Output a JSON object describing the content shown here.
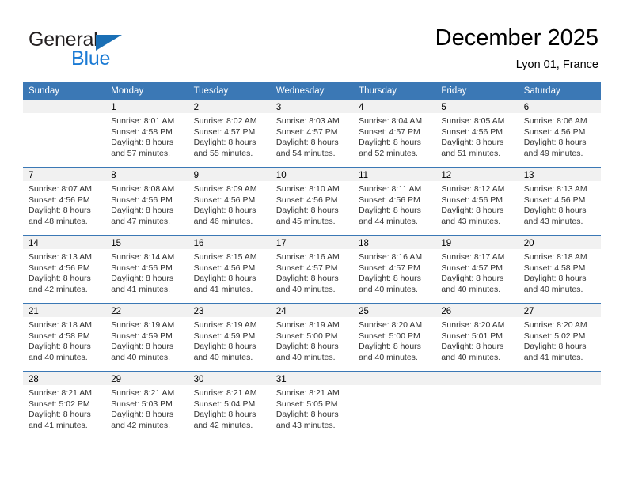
{
  "brand": {
    "logo_line1": "General",
    "logo_line2": "Blue",
    "triangle_color": "#1a6fb5",
    "blue_text_color": "#1a7ad4"
  },
  "header": {
    "title": "December 2025",
    "subtitle": "Lyon 01, France",
    "accent_color": "#3b78b5",
    "daynum_band_color": "#f1f1f1"
  },
  "calendar": {
    "weekdays": [
      "Sunday",
      "Monday",
      "Tuesday",
      "Wednesday",
      "Thursday",
      "Friday",
      "Saturday"
    ],
    "weeks": [
      [
        {
          "day": "",
          "sunrise": "",
          "sunset": "",
          "daylight1": "",
          "daylight2": ""
        },
        {
          "day": "1",
          "sunrise": "Sunrise: 8:01 AM",
          "sunset": "Sunset: 4:58 PM",
          "daylight1": "Daylight: 8 hours",
          "daylight2": "and 57 minutes."
        },
        {
          "day": "2",
          "sunrise": "Sunrise: 8:02 AM",
          "sunset": "Sunset: 4:57 PM",
          "daylight1": "Daylight: 8 hours",
          "daylight2": "and 55 minutes."
        },
        {
          "day": "3",
          "sunrise": "Sunrise: 8:03 AM",
          "sunset": "Sunset: 4:57 PM",
          "daylight1": "Daylight: 8 hours",
          "daylight2": "and 54 minutes."
        },
        {
          "day": "4",
          "sunrise": "Sunrise: 8:04 AM",
          "sunset": "Sunset: 4:57 PM",
          "daylight1": "Daylight: 8 hours",
          "daylight2": "and 52 minutes."
        },
        {
          "day": "5",
          "sunrise": "Sunrise: 8:05 AM",
          "sunset": "Sunset: 4:56 PM",
          "daylight1": "Daylight: 8 hours",
          "daylight2": "and 51 minutes."
        },
        {
          "day": "6",
          "sunrise": "Sunrise: 8:06 AM",
          "sunset": "Sunset: 4:56 PM",
          "daylight1": "Daylight: 8 hours",
          "daylight2": "and 49 minutes."
        }
      ],
      [
        {
          "day": "7",
          "sunrise": "Sunrise: 8:07 AM",
          "sunset": "Sunset: 4:56 PM",
          "daylight1": "Daylight: 8 hours",
          "daylight2": "and 48 minutes."
        },
        {
          "day": "8",
          "sunrise": "Sunrise: 8:08 AM",
          "sunset": "Sunset: 4:56 PM",
          "daylight1": "Daylight: 8 hours",
          "daylight2": "and 47 minutes."
        },
        {
          "day": "9",
          "sunrise": "Sunrise: 8:09 AM",
          "sunset": "Sunset: 4:56 PM",
          "daylight1": "Daylight: 8 hours",
          "daylight2": "and 46 minutes."
        },
        {
          "day": "10",
          "sunrise": "Sunrise: 8:10 AM",
          "sunset": "Sunset: 4:56 PM",
          "daylight1": "Daylight: 8 hours",
          "daylight2": "and 45 minutes."
        },
        {
          "day": "11",
          "sunrise": "Sunrise: 8:11 AM",
          "sunset": "Sunset: 4:56 PM",
          "daylight1": "Daylight: 8 hours",
          "daylight2": "and 44 minutes."
        },
        {
          "day": "12",
          "sunrise": "Sunrise: 8:12 AM",
          "sunset": "Sunset: 4:56 PM",
          "daylight1": "Daylight: 8 hours",
          "daylight2": "and 43 minutes."
        },
        {
          "day": "13",
          "sunrise": "Sunrise: 8:13 AM",
          "sunset": "Sunset: 4:56 PM",
          "daylight1": "Daylight: 8 hours",
          "daylight2": "and 43 minutes."
        }
      ],
      [
        {
          "day": "14",
          "sunrise": "Sunrise: 8:13 AM",
          "sunset": "Sunset: 4:56 PM",
          "daylight1": "Daylight: 8 hours",
          "daylight2": "and 42 minutes."
        },
        {
          "day": "15",
          "sunrise": "Sunrise: 8:14 AM",
          "sunset": "Sunset: 4:56 PM",
          "daylight1": "Daylight: 8 hours",
          "daylight2": "and 41 minutes."
        },
        {
          "day": "16",
          "sunrise": "Sunrise: 8:15 AM",
          "sunset": "Sunset: 4:56 PM",
          "daylight1": "Daylight: 8 hours",
          "daylight2": "and 41 minutes."
        },
        {
          "day": "17",
          "sunrise": "Sunrise: 8:16 AM",
          "sunset": "Sunset: 4:57 PM",
          "daylight1": "Daylight: 8 hours",
          "daylight2": "and 40 minutes."
        },
        {
          "day": "18",
          "sunrise": "Sunrise: 8:16 AM",
          "sunset": "Sunset: 4:57 PM",
          "daylight1": "Daylight: 8 hours",
          "daylight2": "and 40 minutes."
        },
        {
          "day": "19",
          "sunrise": "Sunrise: 8:17 AM",
          "sunset": "Sunset: 4:57 PM",
          "daylight1": "Daylight: 8 hours",
          "daylight2": "and 40 minutes."
        },
        {
          "day": "20",
          "sunrise": "Sunrise: 8:18 AM",
          "sunset": "Sunset: 4:58 PM",
          "daylight1": "Daylight: 8 hours",
          "daylight2": "and 40 minutes."
        }
      ],
      [
        {
          "day": "21",
          "sunrise": "Sunrise: 8:18 AM",
          "sunset": "Sunset: 4:58 PM",
          "daylight1": "Daylight: 8 hours",
          "daylight2": "and 40 minutes."
        },
        {
          "day": "22",
          "sunrise": "Sunrise: 8:19 AM",
          "sunset": "Sunset: 4:59 PM",
          "daylight1": "Daylight: 8 hours",
          "daylight2": "and 40 minutes."
        },
        {
          "day": "23",
          "sunrise": "Sunrise: 8:19 AM",
          "sunset": "Sunset: 4:59 PM",
          "daylight1": "Daylight: 8 hours",
          "daylight2": "and 40 minutes."
        },
        {
          "day": "24",
          "sunrise": "Sunrise: 8:19 AM",
          "sunset": "Sunset: 5:00 PM",
          "daylight1": "Daylight: 8 hours",
          "daylight2": "and 40 minutes."
        },
        {
          "day": "25",
          "sunrise": "Sunrise: 8:20 AM",
          "sunset": "Sunset: 5:00 PM",
          "daylight1": "Daylight: 8 hours",
          "daylight2": "and 40 minutes."
        },
        {
          "day": "26",
          "sunrise": "Sunrise: 8:20 AM",
          "sunset": "Sunset: 5:01 PM",
          "daylight1": "Daylight: 8 hours",
          "daylight2": "and 40 minutes."
        },
        {
          "day": "27",
          "sunrise": "Sunrise: 8:20 AM",
          "sunset": "Sunset: 5:02 PM",
          "daylight1": "Daylight: 8 hours",
          "daylight2": "and 41 minutes."
        }
      ],
      [
        {
          "day": "28",
          "sunrise": "Sunrise: 8:21 AM",
          "sunset": "Sunset: 5:02 PM",
          "daylight1": "Daylight: 8 hours",
          "daylight2": "and 41 minutes."
        },
        {
          "day": "29",
          "sunrise": "Sunrise: 8:21 AM",
          "sunset": "Sunset: 5:03 PM",
          "daylight1": "Daylight: 8 hours",
          "daylight2": "and 42 minutes."
        },
        {
          "day": "30",
          "sunrise": "Sunrise: 8:21 AM",
          "sunset": "Sunset: 5:04 PM",
          "daylight1": "Daylight: 8 hours",
          "daylight2": "and 42 minutes."
        },
        {
          "day": "31",
          "sunrise": "Sunrise: 8:21 AM",
          "sunset": "Sunset: 5:05 PM",
          "daylight1": "Daylight: 8 hours",
          "daylight2": "and 43 minutes."
        },
        {
          "day": "",
          "sunrise": "",
          "sunset": "",
          "daylight1": "",
          "daylight2": ""
        },
        {
          "day": "",
          "sunrise": "",
          "sunset": "",
          "daylight1": "",
          "daylight2": ""
        },
        {
          "day": "",
          "sunrise": "",
          "sunset": "",
          "daylight1": "",
          "daylight2": ""
        }
      ]
    ]
  }
}
